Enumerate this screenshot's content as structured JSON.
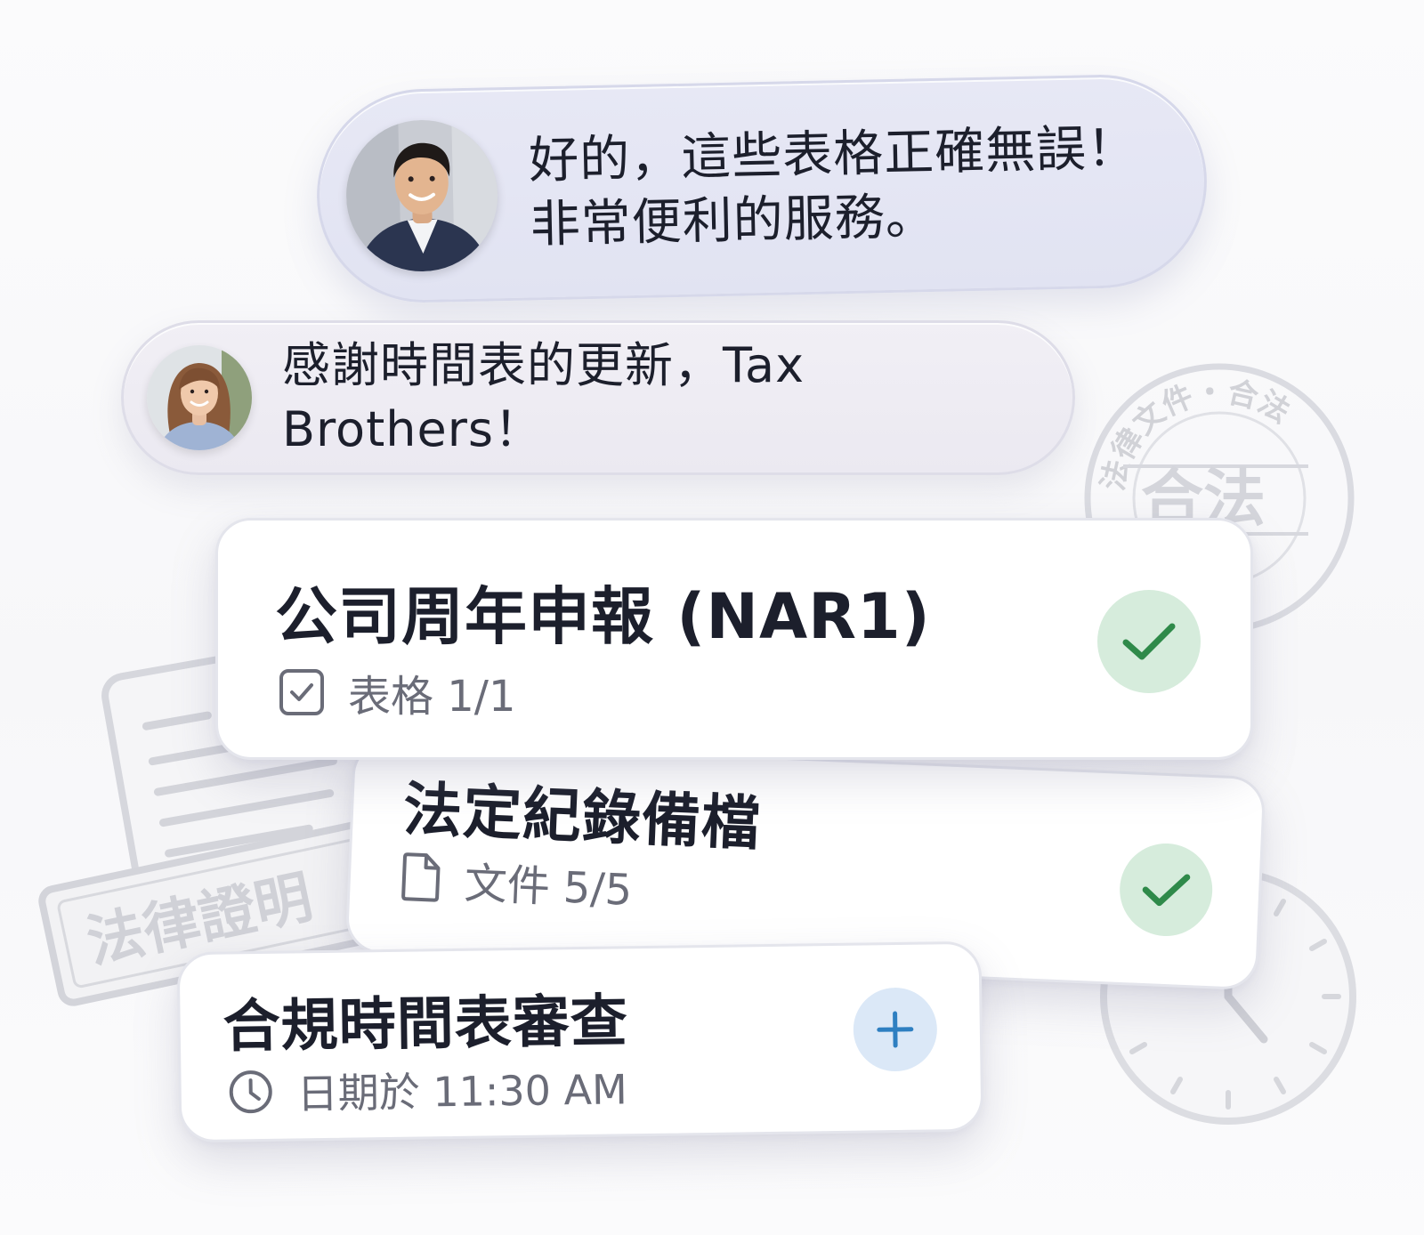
{
  "chat": {
    "messages": [
      {
        "avatar_icon": "man-avatar",
        "text": "好的，這些表格正確無誤！\n非常便利的服務。"
      },
      {
        "avatar_icon": "woman-avatar",
        "text": "感謝時間表的更新，Tax\nBrothers！"
      }
    ]
  },
  "tasks": [
    {
      "title": "公司周年申報 (NAR1)",
      "meta_icon": "checkbox-icon",
      "meta": "表格 1/1",
      "status": "done",
      "status_icon": "check-icon"
    },
    {
      "title": "法定紀錄備檔",
      "meta_icon": "document-icon",
      "meta": "文件 5/5",
      "status": "done",
      "status_icon": "check-icon"
    },
    {
      "title": "合規時間表審查",
      "meta_icon": "clock-icon",
      "meta": "日期於 11:30 AM",
      "status": "pending",
      "status_icon": "plus-icon"
    }
  ],
  "decorations": {
    "round_stamp_ring": "法律文件・合法",
    "round_stamp_center": "合法",
    "rect_stamp": "法律證明"
  },
  "colors": {
    "done_green": "#2f8a4a",
    "done_bg": "#d6ecdc",
    "add_blue": "#2e7fc1",
    "add_bg": "#dbe8f7",
    "bubble_blue": "#e4e6f4",
    "bubble_gray": "#eeecf3"
  }
}
